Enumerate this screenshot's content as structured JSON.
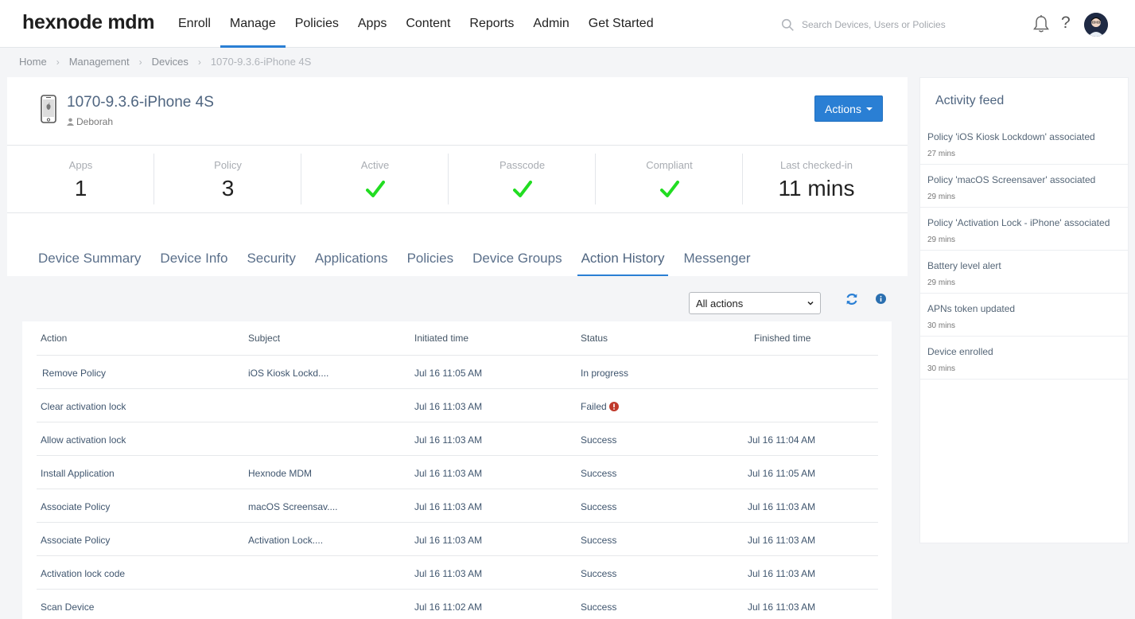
{
  "brand": {
    "logo": "hexnode mdm"
  },
  "nav": {
    "items": [
      "Enroll",
      "Manage",
      "Policies",
      "Apps",
      "Content",
      "Reports",
      "Admin",
      "Get Started"
    ],
    "active": "Manage"
  },
  "search": {
    "placeholder": "Search Devices, Users or Policies"
  },
  "header_icons": [
    "bell-icon",
    "help-icon",
    "avatar"
  ],
  "breadcrumb": [
    "Home",
    "Management",
    "Devices",
    "1070-9.3.6-iPhone 4S"
  ],
  "device": {
    "name": "1070-9.3.6-iPhone 4S",
    "user": "Deborah",
    "actions_label": "Actions"
  },
  "stats": [
    {
      "label": "Apps",
      "value": "1"
    },
    {
      "label": "Policy",
      "value": "3"
    },
    {
      "label": "Active",
      "value": "check"
    },
    {
      "label": "Passcode",
      "value": "check"
    },
    {
      "label": "Compliant",
      "value": "check"
    },
    {
      "label": "Last checked-in",
      "value": "11 mins"
    }
  ],
  "tabs": [
    "Device Summary",
    "Device Info",
    "Security",
    "Applications",
    "Policies",
    "Device Groups",
    "Action History",
    "Messenger"
  ],
  "active_tab": "Action History",
  "filter": {
    "selected": "All actions"
  },
  "table": {
    "headers": [
      "Action",
      "Subject",
      "Initiated time",
      "Status",
      "Finished time"
    ],
    "rows": [
      {
        "action": "Remove Policy",
        "subject": "iOS Kiosk Lockd....",
        "initiated": "Jul 16 11:05 AM",
        "status": "In progress",
        "finished": ""
      },
      {
        "action": "Clear activation lock",
        "subject": "",
        "initiated": "Jul 16 11:03 AM",
        "status": "Failed",
        "finished": ""
      },
      {
        "action": "Allow activation lock",
        "subject": "",
        "initiated": "Jul 16 11:03 AM",
        "status": "Success",
        "finished": "Jul 16 11:04 AM"
      },
      {
        "action": "Install Application",
        "subject": "Hexnode MDM",
        "initiated": "Jul 16 11:03 AM",
        "status": "Success",
        "finished": "Jul 16 11:05 AM"
      },
      {
        "action": "Associate Policy",
        "subject": "macOS Screensav....",
        "initiated": "Jul 16 11:03 AM",
        "status": "Success",
        "finished": "Jul 16 11:03 AM"
      },
      {
        "action": "Associate Policy",
        "subject": "Activation Lock....",
        "initiated": "Jul 16 11:03 AM",
        "status": "Success",
        "finished": "Jul 16 11:03 AM"
      },
      {
        "action": "Activation lock code",
        "subject": "",
        "initiated": "Jul 16 11:03 AM",
        "status": "Success",
        "finished": "Jul 16 11:03 AM"
      },
      {
        "action": "Scan Device",
        "subject": "",
        "initiated": "Jul 16 11:02 AM",
        "status": "Success",
        "finished": "Jul 16 11:03 AM"
      }
    ]
  },
  "feed": {
    "title": "Activity feed",
    "items": [
      {
        "text": "Policy 'iOS Kiosk Lockdown' associated",
        "time": "27 mins"
      },
      {
        "text": "Policy 'macOS Screensaver' associated",
        "time": "29 mins"
      },
      {
        "text": "Policy 'Activation Lock - iPhone' associated",
        "time": "29 mins"
      },
      {
        "text": "Battery level alert",
        "time": "29 mins"
      },
      {
        "text": "APNs token updated",
        "time": "30 mins"
      },
      {
        "text": "Device enrolled",
        "time": "30 mins"
      }
    ]
  },
  "colors": {
    "accent": "#2a7fd4",
    "check": "#22dd22",
    "fail": "#c0392b",
    "title": "#4f6580"
  }
}
